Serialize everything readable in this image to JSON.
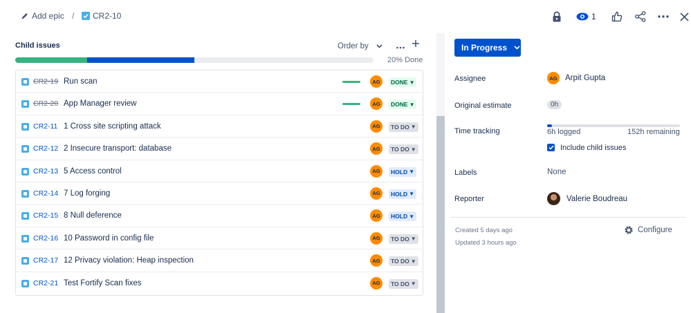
{
  "breadcrumb": {
    "epic_label": "Add epic",
    "separator": "/",
    "issue_key": "CR2-10"
  },
  "header": {
    "watch_count": "1",
    "icons": [
      "lock-icon",
      "eye-icon",
      "thumbs-up-icon",
      "share-icon",
      "more-icon",
      "close-icon"
    ]
  },
  "child_issues": {
    "title": "Child issues",
    "order_by_label": "Order by",
    "progress_text": "20% Done",
    "progress": {
      "done": 0.2,
      "in_progress": 0.3,
      "todo": 0.5
    },
    "colors": {
      "done": "#36b37e",
      "in_progress": "#0052cc",
      "todo": "#ebecf0"
    },
    "items": [
      {
        "key": "CR2-19",
        "summary": "Run scan",
        "assignee": "AG",
        "status": "DONE",
        "done": true
      },
      {
        "key": "CR2-20",
        "summary": "App Manager review",
        "assignee": "AG",
        "status": "DONE",
        "done": true
      },
      {
        "key": "CR2-11",
        "summary": "1 Cross site scripting attack",
        "assignee": "AG",
        "status": "TO DO",
        "done": false
      },
      {
        "key": "CR2-12",
        "summary": "2 Insecure transport: database",
        "assignee": "AG",
        "status": "TO DO",
        "done": false
      },
      {
        "key": "CR2-13",
        "summary": "5 Access control",
        "assignee": "AG",
        "status": "HOLD",
        "done": false
      },
      {
        "key": "CR2-14",
        "summary": "7 Log forging",
        "assignee": "AG",
        "status": "HOLD",
        "done": false
      },
      {
        "key": "CR2-15",
        "summary": "8 Null deference",
        "assignee": "AG",
        "status": "HOLD",
        "done": false
      },
      {
        "key": "CR2-16",
        "summary": "10 Password in config file",
        "assignee": "AG",
        "status": "TO DO",
        "done": false
      },
      {
        "key": "CR2-17",
        "summary": "12 Privacy violation: Heap inspection",
        "assignee": "AG",
        "status": "TO DO",
        "done": false
      },
      {
        "key": "CR2-21",
        "summary": "Test Fortify Scan fixes",
        "assignee": "AG",
        "status": "TO DO",
        "done": false
      }
    ]
  },
  "details": {
    "status_button": "In Progress",
    "assignee_label": "Assignee",
    "assignee_initials": "AG",
    "assignee_name": "Arpit Gupta",
    "original_estimate_label": "Original estimate",
    "original_estimate_value": "0h",
    "time_tracking_label": "Time tracking",
    "time_logged": "6h logged",
    "time_remaining": "152h remaining",
    "time_tracking_fraction": 0.038,
    "include_child_label": "Include child issues",
    "include_child_checked": true,
    "labels_label": "Labels",
    "labels_value": "None",
    "reporter_label": "Reporter",
    "reporter_name": "Valerie Boudreau",
    "created": "Created 5 days ago",
    "updated": "Updated 3 hours ago",
    "configure_label": "Configure"
  }
}
